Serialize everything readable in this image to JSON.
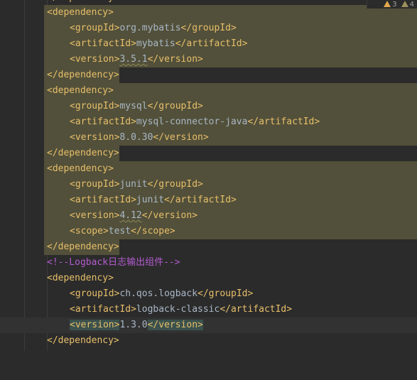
{
  "editor": {
    "warnings": {
      "warning_count": "3",
      "weak_warning_count": "4"
    },
    "lines": {
      "l0": {
        "text": "</dependency>"
      },
      "l1": {
        "text": "<dependency>"
      },
      "l2": {
        "open": "<groupId>",
        "value": "org.mybatis",
        "close": "</groupId>"
      },
      "l3": {
        "open": "<artifactId>",
        "value": "mybatis",
        "close": "</artifactId>"
      },
      "l4": {
        "open": "<version>",
        "value": "3.5.1",
        "close": "</version>"
      },
      "l5": {
        "text": "</dependency>"
      },
      "l6": {
        "text": "<dependency>"
      },
      "l7": {
        "open": "<groupId>",
        "value": "mysql",
        "close": "</groupId>"
      },
      "l8": {
        "open": "<artifactId>",
        "value": "mysql-connector-java",
        "close": "</artifactId>"
      },
      "l9": {
        "open": "<version>",
        "value": "8.0.30",
        "close": "</version>"
      },
      "l10": {
        "text": "</dependency>"
      },
      "l11": {
        "text": "<dependency>"
      },
      "l12": {
        "open": "<groupId>",
        "value": "junit",
        "close": "</groupId>"
      },
      "l13": {
        "open": "<artifactId>",
        "value": "junit",
        "close": "</artifactId>"
      },
      "l14": {
        "open": "<version>",
        "value": "4.12",
        "close": "</version>"
      },
      "l15": {
        "open": "<scope>",
        "value": "test",
        "close": "</scope>"
      },
      "l16": {
        "text": "</dependency>"
      },
      "l17": {
        "text": "<!--Logback日志输出组件-->"
      },
      "l18": {
        "text": "<dependency>"
      },
      "l19": {
        "open": "<groupId>",
        "value": "ch.qos.logback",
        "close": "</groupId>"
      },
      "l20": {
        "open": "<artifactId>",
        "value": "logback-classic",
        "close": "</artifactId>"
      },
      "l21": {
        "open": "<version>",
        "value": "1.3.0",
        "close": "</version>"
      },
      "l22": {
        "text": "</dependency>"
      }
    }
  },
  "colors": {
    "background": "#2b2b2b",
    "tag": "#e8bf6a",
    "text": "#a9b7c6",
    "comment": "#b35bd1",
    "selection_highlight": "#52503a",
    "current_line": "#323232",
    "warning_icon": "#e2a74e"
  }
}
